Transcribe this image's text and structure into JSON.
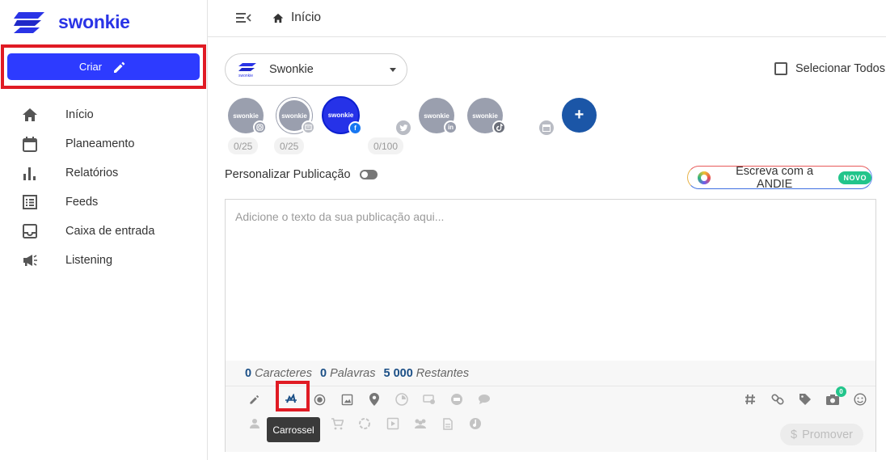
{
  "brand": {
    "name": "swonkie",
    "accent": "#2d3bff"
  },
  "sidebar": {
    "create_label": "Criar",
    "items": [
      {
        "label": "Início",
        "icon": "home-icon"
      },
      {
        "label": "Planeamento",
        "icon": "calendar-icon"
      },
      {
        "label": "Relatórios",
        "icon": "bar-chart-icon"
      },
      {
        "label": "Feeds",
        "icon": "list-icon"
      },
      {
        "label": "Caixa de entrada",
        "icon": "inbox-icon"
      },
      {
        "label": "Listening",
        "icon": "megaphone-icon"
      }
    ]
  },
  "topbar": {
    "breadcrumb": "Início"
  },
  "composer": {
    "profile_name": "Swonkie",
    "select_all_label": "Selecionar Todos",
    "accounts": [
      {
        "label": "swonkie",
        "network": "instagram"
      },
      {
        "label": "swonkie",
        "network": "google-business"
      },
      {
        "label": "swonkie",
        "network": "facebook",
        "selected": true
      },
      {
        "label": "swonkie",
        "network": "linkedin"
      },
      {
        "label": "swonkie",
        "network": "tiktok"
      }
    ],
    "counters": [
      "0/25",
      "0/25",
      "0/100"
    ],
    "customize_label": "Personalizar Publicação",
    "andie_label": "Escreva com a ANDIE",
    "andie_badge": "NOVO",
    "placeholder": "Adicione o texto da sua publicação aqui...",
    "stats": {
      "characters_value": "0",
      "characters_label": "Caracteres",
      "words_value": "0",
      "words_label": "Palavras",
      "remaining_value": "5 000",
      "remaining_label": "Restantes"
    },
    "tooltip": "Carrossel",
    "media_count": "0",
    "promote_label": "Promover"
  }
}
